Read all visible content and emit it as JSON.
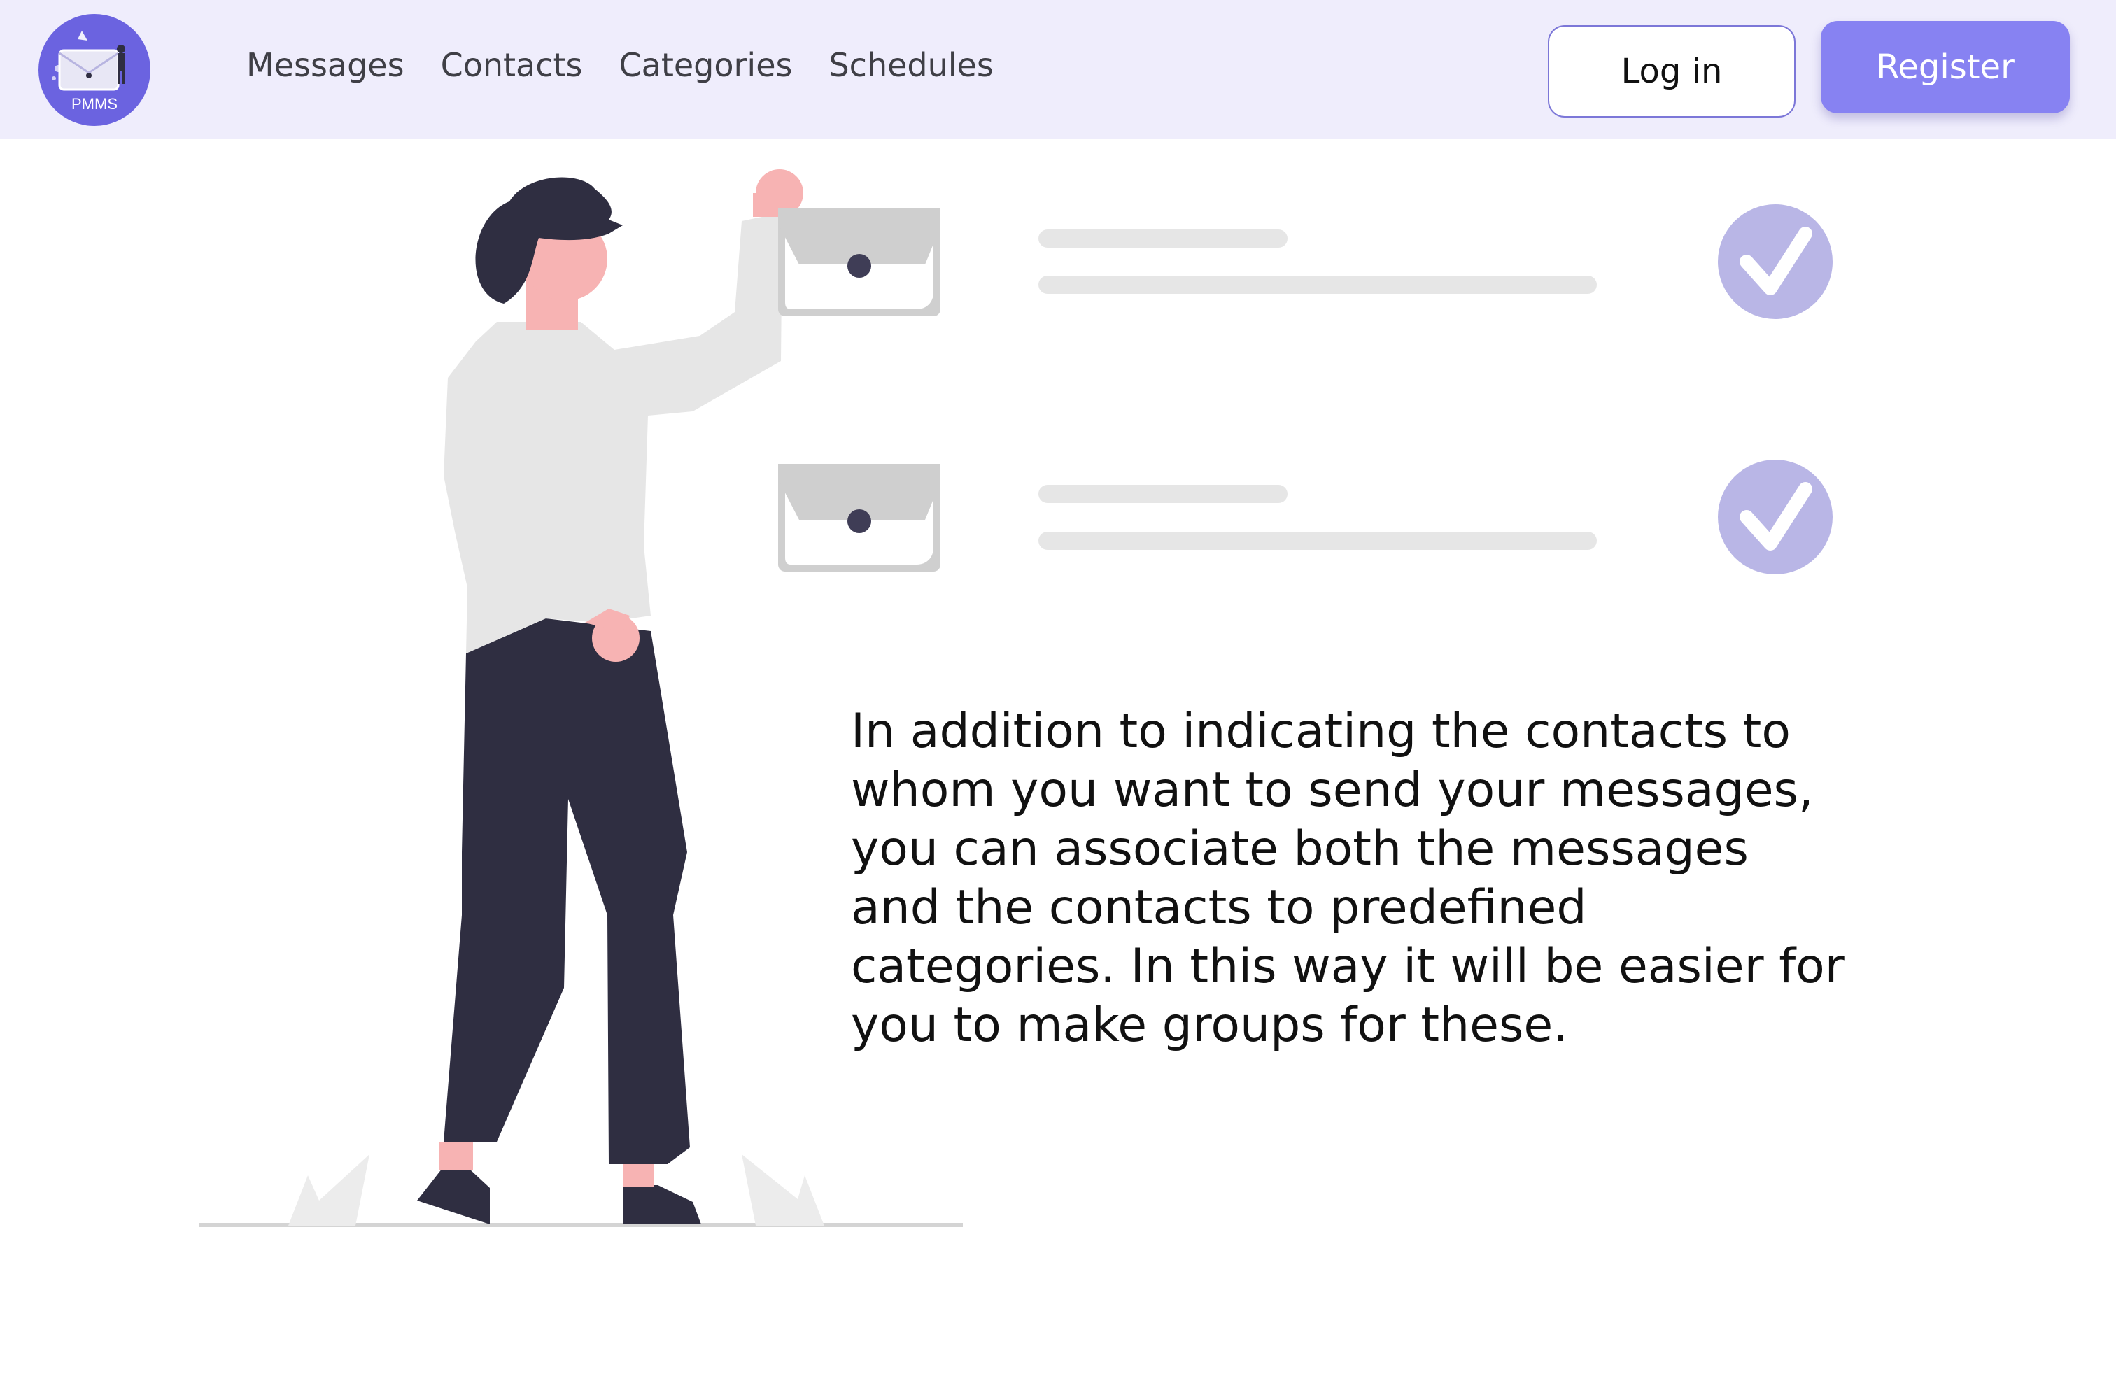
{
  "brand": {
    "logo_text": "PMMS",
    "color": "#6b63e0"
  },
  "nav": {
    "items": [
      {
        "label": "Messages",
        "name": "nav-messages"
      },
      {
        "label": "Contacts",
        "name": "nav-contacts"
      },
      {
        "label": "Categories",
        "name": "nav-categories"
      },
      {
        "label": "Schedules",
        "name": "nav-schedules"
      }
    ]
  },
  "auth": {
    "login_label": "Log in",
    "register_label": "Register",
    "register_color": "#8782f2"
  },
  "main": {
    "description": "In addition to indicating the contacts to whom you want to send your messages, you can associate both the messages and the contacts to predefined categories. In this way it will be easier for you to make groups for these."
  },
  "illustration": {
    "checklist_items": [
      {
        "status": "check-icon"
      },
      {
        "status": "check-icon"
      }
    ],
    "colors": {
      "accent": "#b9b6e6",
      "skin": "#f7b3b3",
      "dark": "#2f2e41",
      "shirt": "#e6e6e6"
    }
  }
}
